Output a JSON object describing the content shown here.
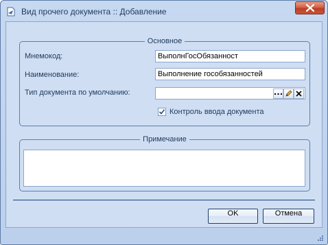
{
  "window": {
    "title": "Вид прочего документа :: Добавление"
  },
  "main_group": {
    "title": "Основное",
    "mnemocode_label": "Мнемокод:",
    "mnemocode_value": "ВыполнГосОбязанност",
    "name_label": "Наименование:",
    "name_value": "Выполнение гособязанностей",
    "doctype_label": "Тип документа по умолчанию:",
    "doctype_value": "",
    "control_checkbox_label": "Контроль ввода документа",
    "control_checked": true
  },
  "note_group": {
    "title": "Примечание",
    "note_value": ""
  },
  "buttons": {
    "ok": "OK",
    "cancel": "Отмена"
  },
  "icons": {
    "app": "document-arrow-icon",
    "close": "close-icon",
    "select": "ellipsis-icon",
    "edit": "pencil-icon",
    "clear": "x-icon",
    "grip": "resize-grip-icon"
  }
}
